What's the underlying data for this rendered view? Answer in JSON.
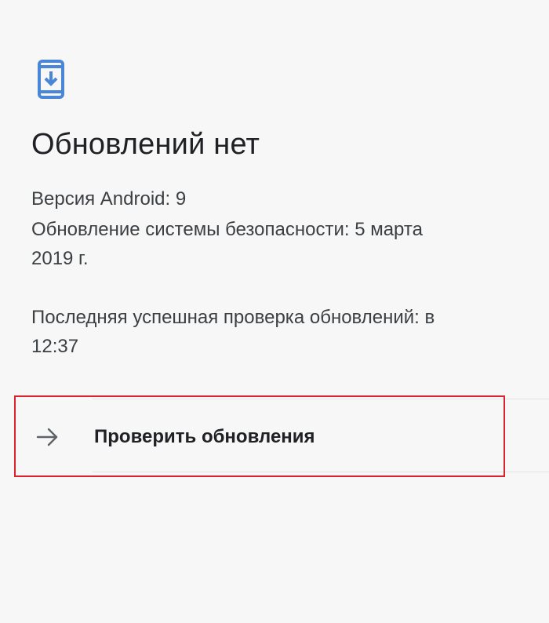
{
  "icon": {
    "update": "phone-download-icon",
    "check_arrow": "arrow-right-icon"
  },
  "colors": {
    "accent": "#4a86d8",
    "highlight_border": "#d9232d",
    "background": "#f7f7f7"
  },
  "screen": {
    "title": "Обновлений нет",
    "android_version": "Версия Android: 9",
    "security_update_line1": "Обновление системы безопасности: 5 марта",
    "security_update_line2": "2019 г.",
    "last_check_line1": "Последняя успешная проверка обновлений: в",
    "last_check_line2": "12:37"
  },
  "action": {
    "check_updates_label": "Проверить обновления"
  }
}
